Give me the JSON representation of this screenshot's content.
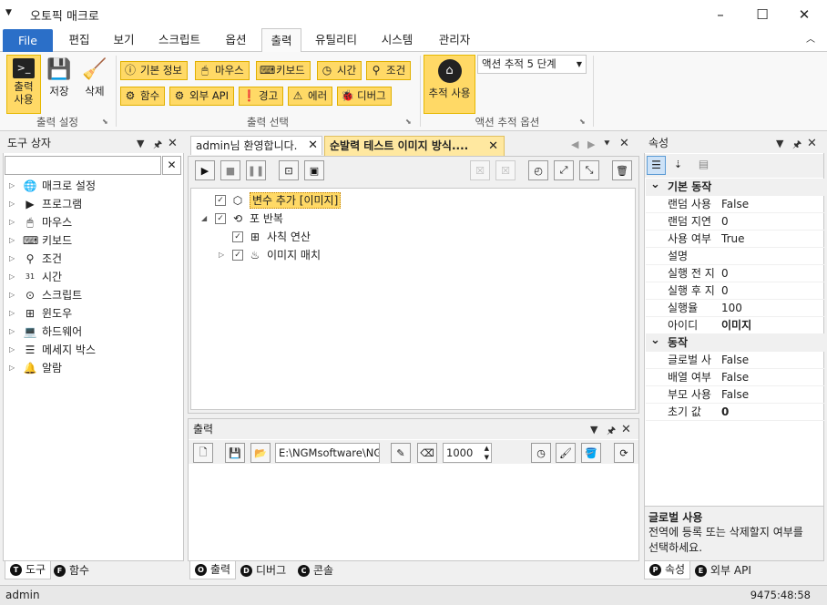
{
  "app": {
    "title": "오토픽 매크로"
  },
  "menu": [
    "File",
    "편집",
    "보기",
    "스크립트",
    "옵션",
    "출력",
    "유틸리티",
    "시스템",
    "관리자"
  ],
  "ribbon": {
    "output_settings": {
      "label": "출력 설정",
      "use_label": "출력\n사용",
      "save_label": "저장",
      "delete_label": "삭제"
    },
    "output_select": {
      "label": "출력 선택",
      "buttons": [
        "기본 정보",
        "마우스",
        "키보드",
        "시간",
        "조건",
        "함수",
        "외부 API",
        "경고",
        "에러",
        "디버그"
      ]
    },
    "action_trace": {
      "label": "액션 추적 옵션",
      "trace_label": "추적 사용",
      "dropdown_value": "액션 추적 5 단계"
    }
  },
  "toolbox": {
    "title": "도구 상자",
    "items": [
      "매크로 설정",
      "프로그램",
      "마우스",
      "키보드",
      "조건",
      "시간",
      "스크립트",
      "윈도우",
      "하드웨어",
      "메세지 박스",
      "알람"
    ]
  },
  "editor": {
    "tabs": [
      "admin님 환영합니다.",
      "순발력 테스트 이미지 방식...."
    ],
    "tree": [
      {
        "label": "변수 추가 [이미지]",
        "level": 0
      },
      {
        "label": "포 반복",
        "level": 0
      },
      {
        "label": "사칙 연산",
        "level": 1
      },
      {
        "label": "이미지 매치",
        "level": 1
      }
    ]
  },
  "output": {
    "title": "출력",
    "path": "E:\\NGMsoftware\\NG",
    "count": "1000"
  },
  "properties": {
    "title": "속성",
    "categories": [
      {
        "name": "기본 동작",
        "rows": [
          [
            "랜덤 사용",
            "False"
          ],
          [
            "랜덤 지연",
            "0"
          ],
          [
            "사용 여부",
            "True"
          ],
          [
            "설명",
            ""
          ],
          [
            "실행 전 지",
            "0"
          ],
          [
            "실행 후 지",
            "0"
          ],
          [
            "실행율",
            "100"
          ],
          [
            "아이디",
            "이미지"
          ]
        ]
      },
      {
        "name": "동작",
        "rows": [
          [
            "글로벌 사",
            "False"
          ],
          [
            "배열 여부",
            "False"
          ],
          [
            "부모 사용",
            "False"
          ],
          [
            "초기 값",
            "0"
          ]
        ]
      }
    ],
    "desc_title": "글로벌 사용",
    "desc_text": "전역에 등록 또는 삭제할지 여부를\n선택하세요."
  },
  "bottom_tabs": {
    "left": [
      {
        "icon": "T",
        "label": "도구"
      },
      {
        "icon": "F",
        "label": "함수"
      }
    ],
    "center": [
      {
        "icon": "O",
        "label": "출력"
      },
      {
        "icon": "D",
        "label": "디버그"
      },
      {
        "icon": "C",
        "label": "콘솔"
      }
    ],
    "right": [
      {
        "icon": "P",
        "label": "속성"
      },
      {
        "icon": "E",
        "label": "외부 API"
      }
    ]
  },
  "status": {
    "user": "admin",
    "time": "9475:48:58"
  },
  "colors": {
    "highlight": "#ffd966",
    "file_menu": "#2b6fc8",
    "panel_border": "#c8c8c8"
  }
}
